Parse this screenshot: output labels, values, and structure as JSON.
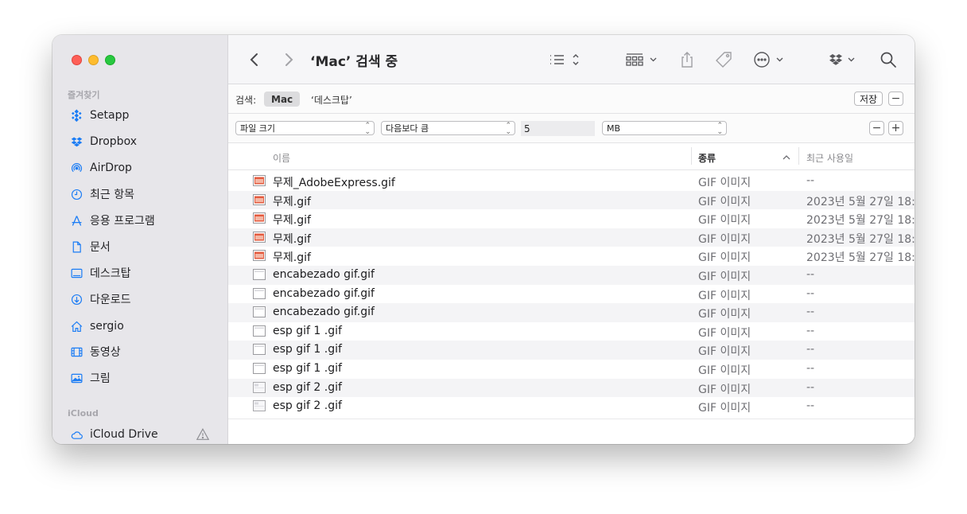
{
  "window": {
    "title": "‘Mac’ 검색 중"
  },
  "sidebar": {
    "favorites_label": "즐겨찾기",
    "items": [
      {
        "label": "Setapp",
        "icon": "setapp-icon"
      },
      {
        "label": "Dropbox",
        "icon": "dropbox-icon"
      },
      {
        "label": "AirDrop",
        "icon": "airdrop-icon"
      },
      {
        "label": "최근 항목",
        "icon": "clock-icon"
      },
      {
        "label": "응용 프로그램",
        "icon": "applications-icon"
      },
      {
        "label": "문서",
        "icon": "document-icon"
      },
      {
        "label": "데스크탑",
        "icon": "desktop-icon"
      },
      {
        "label": "다운로드",
        "icon": "download-icon"
      },
      {
        "label": "sergio",
        "icon": "home-icon"
      },
      {
        "label": "동영상",
        "icon": "film-icon"
      },
      {
        "label": "그림",
        "icon": "photo-icon"
      }
    ],
    "icloud_label": "iCloud",
    "icloud_items": [
      {
        "label": "iCloud Drive",
        "icon": "cloud-icon"
      }
    ]
  },
  "searchbar": {
    "label": "검색:",
    "scope_mac": "Mac",
    "scope_desktop": "‘데스크탑’",
    "save_label": "저장",
    "remove_label": "−"
  },
  "criteria": {
    "attribute": "파일 크기",
    "operator": "다음보다 큼",
    "value": "5",
    "unit": "MB",
    "remove_label": "−",
    "add_label": "+"
  },
  "table": {
    "columns": {
      "name": "이름",
      "kind": "종류",
      "date": "최근 사용일"
    },
    "rows": [
      {
        "name": "무제_AdobeExpress.gif",
        "kind": "GIF 이미지",
        "date": "--",
        "icon": "gif-red"
      },
      {
        "name": "무제.gif",
        "kind": "GIF 이미지",
        "date": "2023년 5월 27일 18:",
        "icon": "gif-red"
      },
      {
        "name": "무제.gif",
        "kind": "GIF 이미지",
        "date": "2023년 5월 27일 18:",
        "icon": "gif-red"
      },
      {
        "name": "무제.gif",
        "kind": "GIF 이미지",
        "date": "2023년 5월 27일 18:",
        "icon": "gif-red"
      },
      {
        "name": "무제.gif",
        "kind": "GIF 이미지",
        "date": "2023년 5월 27일 18:",
        "icon": "gif-red"
      },
      {
        "name": "encabezado gif.gif",
        "kind": "GIF 이미지",
        "date": "--",
        "icon": "gif-blank"
      },
      {
        "name": "encabezado gif.gif",
        "kind": "GIF 이미지",
        "date": "--",
        "icon": "gif-blank"
      },
      {
        "name": "encabezado gif.gif",
        "kind": "GIF 이미지",
        "date": "--",
        "icon": "gif-blank"
      },
      {
        "name": "esp gif 1 .gif",
        "kind": "GIF 이미지",
        "date": "--",
        "icon": "gif-blank"
      },
      {
        "name": "esp gif 1 .gif",
        "kind": "GIF 이미지",
        "date": "--",
        "icon": "gif-blank"
      },
      {
        "name": "esp gif 1 .gif",
        "kind": "GIF 이미지",
        "date": "--",
        "icon": "gif-blank"
      },
      {
        "name": "esp gif 2 .gif",
        "kind": "GIF 이미지",
        "date": "--",
        "icon": "gif-light"
      },
      {
        "name": "esp gif 2 .gif",
        "kind": "GIF 이미지",
        "date": "--",
        "icon": "gif-light"
      }
    ]
  },
  "colors": {
    "accent": "#1a7cf5",
    "sidebar_bg": "#e7e6ea",
    "sort_header": "#2a2a2c"
  }
}
